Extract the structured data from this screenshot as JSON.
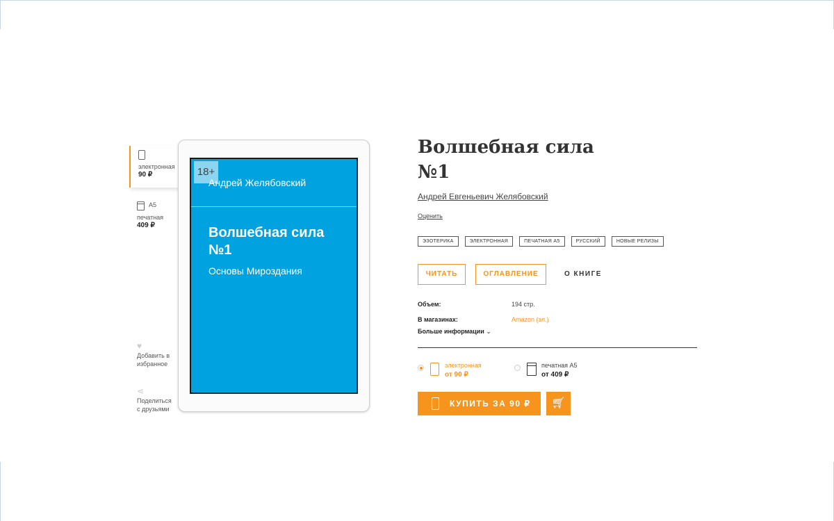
{
  "formats": {
    "electronic": {
      "label": "электронная",
      "price": "90 ₽"
    },
    "print": {
      "size": "A5",
      "label": "печатная",
      "price": "409 ₽"
    }
  },
  "side_actions": {
    "favorite": "Добавить в избранное",
    "share": "Поделиться с друзьями"
  },
  "cover": {
    "age_rating": "18+",
    "author": "Андрей Желябовский",
    "title": "Волшебная сила №1",
    "subtitle": "Основы Мироздания",
    "color": "#00a3e0"
  },
  "book": {
    "title": "Волшебная сила №1",
    "author": "Андрей Евгеньевич Желябовский",
    "rate_link": "Оценить"
  },
  "tags": [
    "ЭЗОТЕРИКА",
    "ЭЛЕКТРОННАЯ",
    "ПЕЧАТНАЯ А5",
    "РУССКИЙ",
    "НОВЫЕ РЕЛИЗЫ"
  ],
  "actions": {
    "read": "ЧИТАТЬ",
    "toc": "ОГЛАВЛЕНИЕ",
    "about": "О КНИГЕ"
  },
  "meta": {
    "volume_label": "Объем:",
    "volume_value": "194 стр.",
    "stores_label": "В магазинах:",
    "stores_value": "Amazon (эл.)",
    "more_info": "Больше информации"
  },
  "purchase_options": {
    "electronic": {
      "label": "электронная",
      "price": "от 90 ₽",
      "selected": true
    },
    "print": {
      "label": "печатная A5",
      "price": "от 409 ₽",
      "selected": false
    }
  },
  "buy": {
    "label": "КУПИТЬ ЗА 90 ₽"
  },
  "colors": {
    "accent": "#f7941d",
    "cover": "#00a3e0"
  },
  "icons": {
    "electronic": "tablet-icon",
    "print": "book-icon",
    "favorite": "heart-icon",
    "share": "share-icon",
    "cart": "cart-icon",
    "more": "chevron-down-icon"
  }
}
